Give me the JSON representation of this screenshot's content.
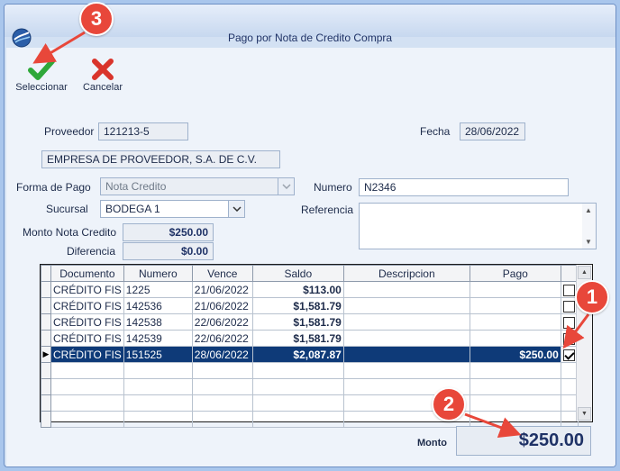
{
  "window": {
    "title": "Pago por Nota de Credito Compra"
  },
  "toolbar": {
    "select_label": "Seleccionar",
    "cancel_label": "Cancelar"
  },
  "form": {
    "proveedor_label": "Proveedor",
    "proveedor_value": "121213-5",
    "fecha_label": "Fecha",
    "fecha_value": "28/06/2022",
    "empresa_value": "EMPRESA DE PROVEEDOR, S.A. DE C.V.",
    "forma_pago_label": "Forma de Pago",
    "forma_pago_value": "Nota Credito",
    "numero_label": "Numero",
    "numero_value": "N2346",
    "sucursal_label": "Sucursal",
    "sucursal_value": "BODEGA 1",
    "referencia_label": "Referencia",
    "referencia_value": "",
    "monto_nota_label": "Monto Nota Credito",
    "monto_nota_value": "$250.00",
    "diferencia_label": "Diferencia",
    "diferencia_value": "$0.00"
  },
  "grid": {
    "columns": [
      "Documento",
      "Numero",
      "Vence",
      "Saldo",
      "Descripcion",
      "Pago"
    ],
    "rows": [
      {
        "documento": "CRÉDITO FIS",
        "numero": "1225",
        "vence": "21/06/2022",
        "saldo": "$113.00",
        "descripcion": "",
        "pago": "",
        "checked": false,
        "selected": false
      },
      {
        "documento": "CRÉDITO FIS",
        "numero": "142536",
        "vence": "21/06/2022",
        "saldo": "$1,581.79",
        "descripcion": "",
        "pago": "",
        "checked": false,
        "selected": false
      },
      {
        "documento": "CRÉDITO FIS",
        "numero": "142538",
        "vence": "22/06/2022",
        "saldo": "$1,581.79",
        "descripcion": "",
        "pago": "",
        "checked": false,
        "selected": false
      },
      {
        "documento": "CRÉDITO FIS",
        "numero": "142539",
        "vence": "22/06/2022",
        "saldo": "$1,581.79",
        "descripcion": "",
        "pago": "",
        "checked": false,
        "selected": false
      },
      {
        "documento": "CRÉDITO FIS",
        "numero": "151525",
        "vence": "28/06/2022",
        "saldo": "$2,087.87",
        "descripcion": "",
        "pago": "$250.00",
        "checked": true,
        "selected": true
      }
    ],
    "empty_rows": 4
  },
  "footer": {
    "monto_label": "Monto",
    "monto_value": "$250.00"
  },
  "annotations": {
    "badge1": "1",
    "badge2": "2",
    "badge3": "3"
  },
  "colors": {
    "badge": "#e8473a",
    "selected_row": "#0e3a78",
    "check_green": "#2fa83a",
    "cancel_red": "#d9342b"
  }
}
